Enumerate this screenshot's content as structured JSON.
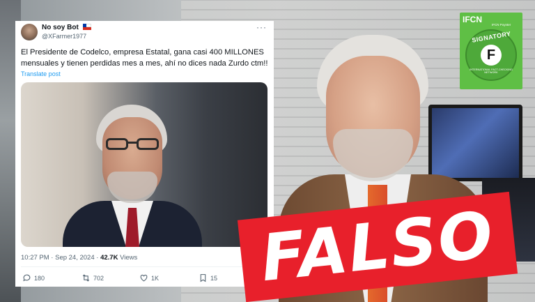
{
  "tweet": {
    "display_name": "No soy Bot",
    "handle": "@XFarmer1977",
    "more_label": "···",
    "text": "El Presidente de Codelco, empresa Estatal, gana casi 400 MILLONES mensuales y tienen perdidas mes a mes, ahí no dices nada Zurdo ctm!!",
    "translate_label": "Translate post",
    "time": "10:27 PM · Sep 24, 2024 · ",
    "views_count": "42.7K",
    "views_label": " Views",
    "actions": {
      "replies": "180",
      "reposts": "702",
      "likes": "1K",
      "bookmarks": "15"
    }
  },
  "stamp": {
    "label": "FALSO",
    "color": "#e8202b"
  },
  "badge": {
    "header": "IFCN",
    "subheader": "IFCN Poynter",
    "title": "SIGNATORY",
    "letter": "F",
    "ring_text": "INTERNATIONAL FACT-CHECKING NETWORK",
    "color": "#5fbf45"
  },
  "colors": {
    "link": "#1d9bf0",
    "muted": "#536471",
    "text": "#0f1419"
  }
}
